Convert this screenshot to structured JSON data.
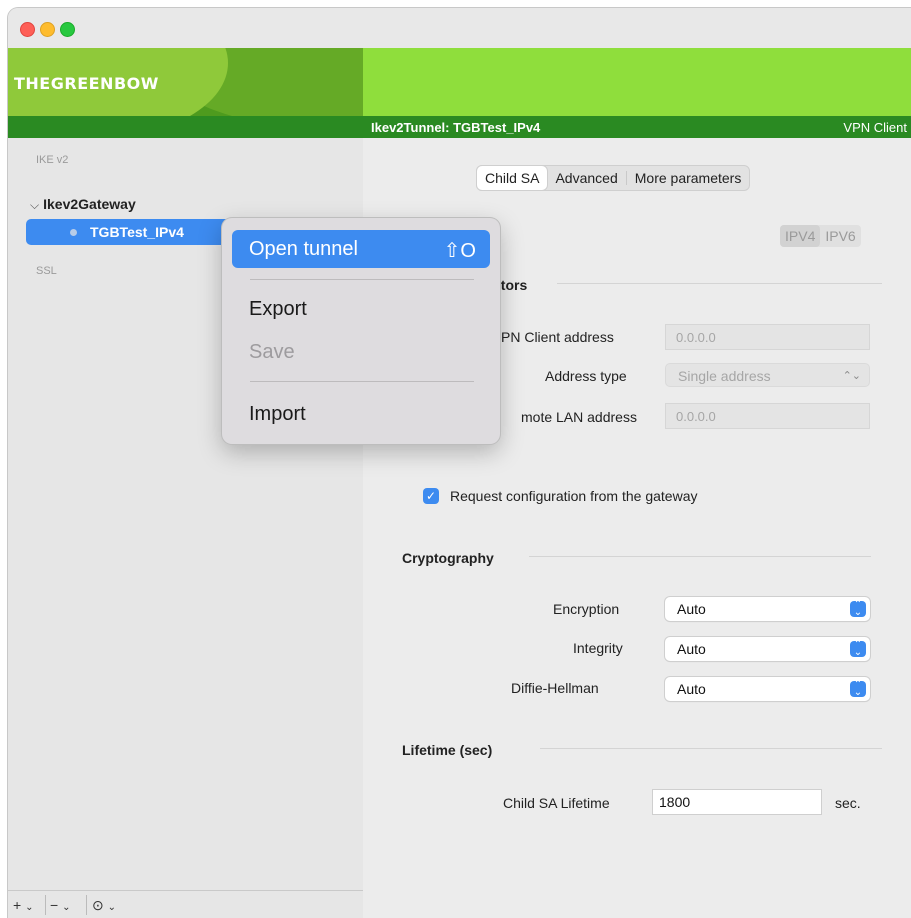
{
  "window": {
    "controls": [
      "close",
      "minimize",
      "zoom"
    ]
  },
  "header": {
    "logo": "THEGREENBOW",
    "tunnel_title": "Ikev2Tunnel: TGBTest_IPv4",
    "product": "VPN Client"
  },
  "sidebar": {
    "section_ike": "IKE v2",
    "gateway": "Ikev2Gateway",
    "tunnel": "TGBTest_IPv4",
    "section_ssl": "SSL",
    "toolbar": {
      "add": "+",
      "remove": "−",
      "more": "⊙"
    }
  },
  "context_menu": {
    "open_tunnel": "Open tunnel",
    "open_shortcut": "⇧O",
    "export": "Export",
    "save": "Save",
    "import": "Import"
  },
  "tabs": [
    "Child SA",
    "Advanced",
    "More parameters"
  ],
  "ip_version": {
    "options": [
      "IPV4",
      "IPV6"
    ],
    "selected": "IPV4"
  },
  "traffic_selectors": {
    "title_visible": "ctors",
    "vpn_client_label": "PN Client address",
    "vpn_client_value": "0.0.0.0",
    "address_type_label": "Address type",
    "address_type_value": "Single address",
    "remote_lan_label": "mote LAN address",
    "remote_lan_value": "0.0.0.0"
  },
  "request_config": {
    "label": "Request configuration from the gateway",
    "checked": true
  },
  "cryptography": {
    "title": "Cryptography",
    "encryption_label": "Encryption",
    "encryption_value": "Auto",
    "integrity_label": "Integrity",
    "integrity_value": "Auto",
    "dh_label": "Diffie-Hellman",
    "dh_value": "Auto"
  },
  "lifetime": {
    "title": "Lifetime (sec)",
    "child_sa_label": "Child SA Lifetime",
    "child_sa_value": "1800",
    "unit": "sec."
  },
  "colors": {
    "accent": "#3d8bf0",
    "header_green": "#8fde3c",
    "dark_green": "#2a8a22"
  }
}
